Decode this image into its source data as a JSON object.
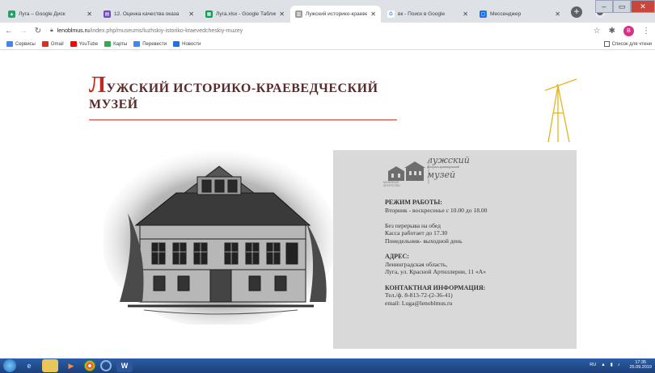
{
  "browser": {
    "tabs": [
      {
        "title": "Луга – Google Диск",
        "color": "#1fa463",
        "glyph": "▲"
      },
      {
        "title": "12. Оценка качества оказа",
        "color": "#7248b9",
        "glyph": "▤"
      },
      {
        "title": "Луга.xlsx - Google Таблицы",
        "color": "#0f9d58",
        "glyph": "▦"
      },
      {
        "title": "Лужский историко-краевед",
        "color": "#9e9e9e",
        "glyph": "▥"
      },
      {
        "title": "вк - Поиск в Google",
        "color": "#4285f4",
        "glyph": "G"
      },
      {
        "title": "Мессенджер",
        "color": "#1a73e8",
        "glyph": "▢"
      }
    ],
    "url_domain": "lenoblmus.ru",
    "url_path": "/index.php/museums/luzhskiy-istoriko-kraevedcheskiy-muzey",
    "bookmarks": [
      {
        "label": "Сервисы",
        "color": "#4285f4"
      },
      {
        "label": "Gmail",
        "color": "#d93025"
      },
      {
        "label": "YouTube",
        "color": "#ff0000"
      },
      {
        "label": "Карты",
        "color": "#34a853"
      },
      {
        "label": "Перевести",
        "color": "#4285f4"
      },
      {
        "label": "Новости",
        "color": "#1a73e8"
      }
    ],
    "reading_list": "Список для чтени",
    "profile_letter": "B"
  },
  "museum": {
    "title_initial": "Л",
    "title_rest": "ужский историко-краеведческий",
    "title_line2": "музей",
    "logo_line1": "лужский",
    "logo_sub": "историко-краеведческий",
    "logo_line2": "музей",
    "logo_badge_1": "МУЗЕЙНОЕ",
    "logo_badge_2": "АГЕНТСТВО",
    "hours_heading": "РЕЖИМ РАБОТЫ:",
    "hours": "Вторник - воскресенье с 10.00 до 18.00",
    "note_1": "Без перерыва на обед",
    "note_2": "Касса работает до 17.30",
    "note_3": "Понедельник- выходной день",
    "address_heading": "АДРЕС:",
    "address_1": "Ленинградская область,",
    "address_2": "Луга, ул. Красной Артиллерии, 11 «А»",
    "contact_heading": "КОНТАКТНАЯ ИНФОРМАЦИЯ:",
    "phone": "Тел./ф. 8-813-72-(2-36-41)",
    "email": "email: Luga@lenoblmus.ru"
  },
  "taskbar": {
    "lang": "RU",
    "time": "17:35",
    "date": "25.09.2019"
  }
}
